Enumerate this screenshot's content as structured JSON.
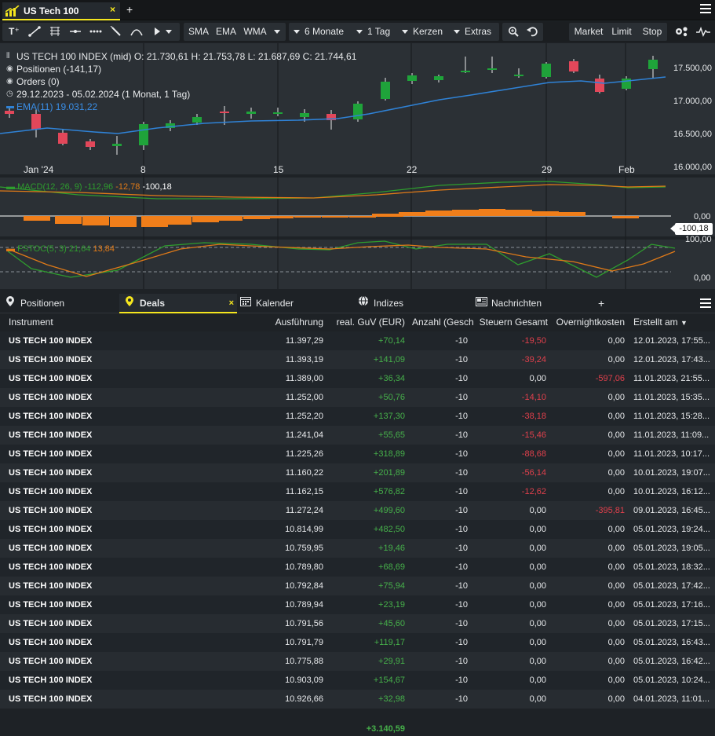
{
  "window": {
    "tab_title": "US Tech 100",
    "close_glyph": "×",
    "add_glyph": "+"
  },
  "toolbar": {
    "tools": [
      "text-tool-icon",
      "line-tool-icon",
      "fib-tool-icon",
      "hline-tool-icon",
      "dotted-line-icon",
      "pencil-icon",
      "curve-icon",
      "cursor-icon"
    ],
    "indicators": [
      "SMA",
      "EMA",
      "WMA"
    ],
    "period": "6 Monate",
    "interval": "1 Tag",
    "chart_type": "Kerzen",
    "extras": "Extras",
    "order_buttons": [
      "Market",
      "Limit",
      "Stop"
    ]
  },
  "chart": {
    "ohlc_line": "US TECH 100 INDEX (mid)  O: 21.730,61  H: 21.753,78  L: 21.687,69  C: 21.744,61",
    "positions": "Positionen (-141,17)",
    "orders": "Orders (0)",
    "range": "29.12.2023 - 05.02.2024   (1 Monat, 1 Tag)",
    "ema_legend": "EMA(11)  19.031,22",
    "macd_legend": {
      "name": "MACD(12, 26, 9)",
      "v1": "-112,96",
      "v2": "-12,78",
      "v3": "-100,18"
    },
    "stoch_legend": {
      "name": "FSTOC(5, 3)",
      "v1": "21,64",
      "v2": "13,84"
    },
    "price_axis": [
      "17.500,00",
      "17.000,00",
      "16.500,00",
      "16.000,00"
    ],
    "macd_axis": [
      "0,00"
    ],
    "macd_tag": "-100,18",
    "stoch_axis": [
      "100,00",
      "0,00"
    ],
    "x_labels": [
      "Jan '24",
      "8",
      "15",
      "22",
      "29",
      "Feb"
    ],
    "colors": {
      "up": "#1fa33a",
      "down": "#e2475a",
      "ema": "#2f82d6",
      "macd": "#2e9d2e",
      "signal": "#e07a18",
      "hist": "#f07e1a",
      "bg": "#2b3035"
    }
  },
  "tabs": [
    {
      "label": "Positionen",
      "icon": "pin-icon"
    },
    {
      "label": "Deals",
      "icon": "pin-yellow-icon",
      "active": true
    },
    {
      "label": "Kalender",
      "icon": "calendar-icon"
    },
    {
      "label": "Indizes",
      "icon": "globe-icon"
    },
    {
      "label": "Nachrichten",
      "icon": "news-icon"
    }
  ],
  "table": {
    "columns": [
      "Instrument",
      "Ausführung",
      "real. GuV (EUR)",
      "Anzahl (Geschl",
      "Steuern Gesamt",
      "Overnightkosten",
      "Erstellt am"
    ],
    "sort_glyph": "▼",
    "rows": [
      [
        "US TECH 100 INDEX",
        "11.397,29",
        "+70,14",
        "-10",
        "-19,50",
        "0,00",
        "12.01.2023, 17:55..."
      ],
      [
        "US TECH 100 INDEX",
        "11.393,19",
        "+141,09",
        "-10",
        "-39,24",
        "0,00",
        "12.01.2023, 17:43..."
      ],
      [
        "US TECH 100 INDEX",
        "11.389,00",
        "+36,34",
        "-10",
        "0,00",
        "-597,06",
        "11.01.2023, 21:55..."
      ],
      [
        "US TECH 100 INDEX",
        "11.252,00",
        "+50,76",
        "-10",
        "-14,10",
        "0,00",
        "11.01.2023, 15:35..."
      ],
      [
        "US TECH 100 INDEX",
        "11.252,20",
        "+137,30",
        "-10",
        "-38,18",
        "0,00",
        "11.01.2023, 15:28..."
      ],
      [
        "US TECH 100 INDEX",
        "11.241,04",
        "+55,65",
        "-10",
        "-15,46",
        "0,00",
        "11.01.2023, 11:09..."
      ],
      [
        "US TECH 100 INDEX",
        "11.225,26",
        "+318,89",
        "-10",
        "-88,68",
        "0,00",
        "11.01.2023, 10:17..."
      ],
      [
        "US TECH 100 INDEX",
        "11.160,22",
        "+201,89",
        "-10",
        "-56,14",
        "0,00",
        "10.01.2023, 19:07..."
      ],
      [
        "US TECH 100 INDEX",
        "11.162,15",
        "+576,82",
        "-10",
        "-12,62",
        "0,00",
        "10.01.2023, 16:12..."
      ],
      [
        "US TECH 100 INDEX",
        "11.272,24",
        "+499,60",
        "-10",
        "0,00",
        "-395,81",
        "09.01.2023, 16:45..."
      ],
      [
        "US TECH 100 INDEX",
        "10.814,99",
        "+482,50",
        "-10",
        "0,00",
        "0,00",
        "05.01.2023, 19:24..."
      ],
      [
        "US TECH 100 INDEX",
        "10.759,95",
        "+19,46",
        "-10",
        "0,00",
        "0,00",
        "05.01.2023, 19:05..."
      ],
      [
        "US TECH 100 INDEX",
        "10.789,80",
        "+68,69",
        "-10",
        "0,00",
        "0,00",
        "05.01.2023, 18:32..."
      ],
      [
        "US TECH 100 INDEX",
        "10.792,84",
        "+75,94",
        "-10",
        "0,00",
        "0,00",
        "05.01.2023, 17:42..."
      ],
      [
        "US TECH 100 INDEX",
        "10.789,94",
        "+23,19",
        "-10",
        "0,00",
        "0,00",
        "05.01.2023, 17:16..."
      ],
      [
        "US TECH 100 INDEX",
        "10.791,56",
        "+45,60",
        "-10",
        "0,00",
        "0,00",
        "05.01.2023, 17:15..."
      ],
      [
        "US TECH 100 INDEX",
        "10.791,79",
        "+119,17",
        "-10",
        "0,00",
        "0,00",
        "05.01.2023, 16:43..."
      ],
      [
        "US TECH 100 INDEX",
        "10.775,88",
        "+29,91",
        "-10",
        "0,00",
        "0,00",
        "05.01.2023, 16:42..."
      ],
      [
        "US TECH 100 INDEX",
        "10.903,09",
        "+154,67",
        "-10",
        "0,00",
        "0,00",
        "05.01.2023, 10:24..."
      ],
      [
        "US TECH 100 INDEX",
        "10.926,66",
        "+32,98",
        "-10",
        "0,00",
        "0,00",
        "04.01.2023, 11:01..."
      ]
    ],
    "total": "+3.140,59"
  }
}
